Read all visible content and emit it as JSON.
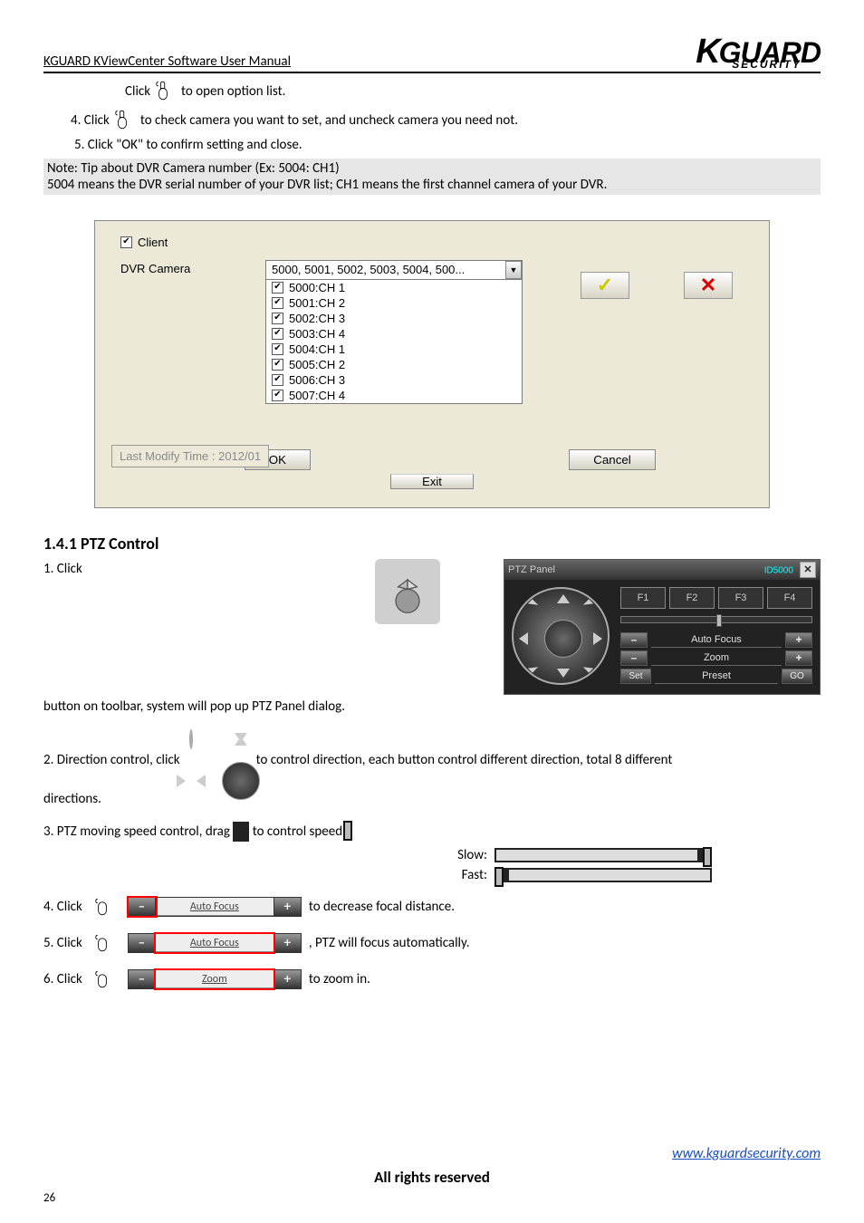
{
  "header": {
    "doc_title": "KGUARD KViewCenter Software User Manual",
    "logo_main": "KGUARD",
    "logo_sub": "SECURITY"
  },
  "top_steps": {
    "step1_prefix": "Click",
    "step1_suffix": " to open option list.",
    "step2_prefix": "4. Click",
    "step2_suffix": " to check camera you want to set, and uncheck camera you need not.",
    "step3": "5. Click \"OK\" to confirm setting and close."
  },
  "note": {
    "line1": "Note: Tip about DVR Camera number (Ex: 5004: CH1)",
    "line2": "5004 means the DVR serial number of your DVR list; CH1 means the first channel camera of your DVR.",
    "line3": ""
  },
  "dialog": {
    "client_label": "Client",
    "dvr_label": "DVR Camera",
    "combo_value": "5000, 5001, 5002, 5003, 5004, 500...",
    "items": [
      "5000:CH 1",
      "5001:CH 2",
      "5002:CH 3",
      "5003:CH 4",
      "5004:CH 1",
      "5005:CH 2",
      "5006:CH 3",
      "5007:CH 4"
    ],
    "ok": "OK",
    "cancel": "Cancel",
    "last_modify": "Last Modify Time : 2012/01",
    "exit": "Exit"
  },
  "ptz_section": {
    "heading": "1.4.1 PTZ Control",
    "intro_1": "1. Click",
    "intro_2": "button on toolbar, system will pop up PTZ Panel dialog.",
    "panel_title": "PTZ Panel",
    "panel_id": "ID5000",
    "f_buttons": [
      "F1",
      "F2",
      "F3",
      "F4"
    ],
    "auto_focus": "Auto Focus",
    "zoom": "Zoom",
    "preset": "Preset",
    "set": "Set",
    "go": "GO",
    "dpad_prefix": "2. Direction control, click",
    "dpad_suffix_1": " to control direction, each button control different direction, total 8 different",
    "dpad_line2": "directions.",
    "speed_line1": "3. PTZ moving speed control, drag",
    "speed_line2": " to control speed.",
    "slow_label": "Slow:",
    "fast_label": "Fast:"
  },
  "click_lines": {
    "l1_prefix": "4. Click",
    "l1_mid": "Auto Focus",
    "l1_suffix": "to decrease focal distance.",
    "l2_prefix": "5. Click",
    "l2_mid": "Auto Focus",
    "l2_suffix": ", PTZ will focus automatically.",
    "l3_prefix": "6. Click",
    "l3_mid": "Zoom",
    "l3_suffix": "to zoom in."
  },
  "footer": {
    "url_text": "www.kguardsecurity.com",
    "rights": "All rights reserved",
    "page": "26"
  }
}
